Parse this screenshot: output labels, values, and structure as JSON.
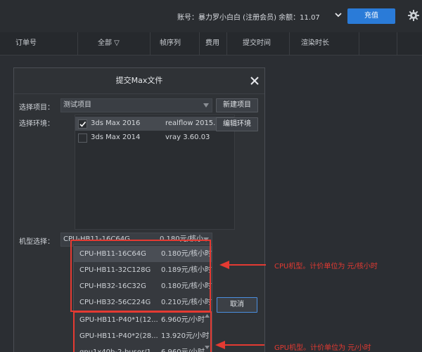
{
  "topbar": {
    "account_text": "账号：暴力罗小白白 (注册会员) 余额：11.07",
    "recharge_label": "充值"
  },
  "columns": [
    "订单号",
    "全部 ▽",
    "帧序列",
    "费用",
    "提交时间",
    "渲染时长"
  ],
  "dialog": {
    "title": "提交Max文件",
    "project_label": "选择项目：",
    "project_value": "测试项目",
    "new_project_label": "新建项目",
    "env_label": "选择环境：",
    "edit_env_label": "编辑环境",
    "environments": [
      {
        "name": "3ds Max 2016",
        "plugin": "realflow 2015.0...",
        "checked": true,
        "selected": true
      },
      {
        "name": "3ds Max 2014",
        "plugin": "vray 3.60.03",
        "checked": false,
        "selected": false
      }
    ],
    "machine_label": "机型选择：",
    "machine_value": "CPU-HB11-16C64G",
    "machine_price": "0.180元/核小",
    "cancel_label": "取消"
  },
  "machine_options": [
    {
      "name": "CPU-HB11-16C64G",
      "price": "0.180元/核小时",
      "highlight": true
    },
    {
      "name": "CPU-HB11-32C128G",
      "price": "0.189元/核小时",
      "highlight": false
    },
    {
      "name": "CPU-HB32-16C32G",
      "price": "0.180元/核小时",
      "highlight": false
    },
    {
      "name": "CPU-HB32-56C224G",
      "price": "0.210元/核小时",
      "highlight": false
    },
    {
      "name": "GPU-HB11-P40*1(12...",
      "price": "6.960元/小时",
      "highlight": false
    },
    {
      "name": "GPU-HB11-P40*2(28...",
      "price": "13.920元/小时",
      "highlight": false
    },
    {
      "name": "gpu1x40b-2-busor/1...",
      "price": "6.960元/小时",
      "highlight": false
    }
  ],
  "annotations": {
    "cpu_note": "CPU机型。计价单位为 元/核小时",
    "gpu_note": "GPU机型。计价单位为 元/小时"
  },
  "colors": {
    "accent": "#2a7bd8",
    "annotation": "#e43a32",
    "background": "#2b2e33"
  }
}
